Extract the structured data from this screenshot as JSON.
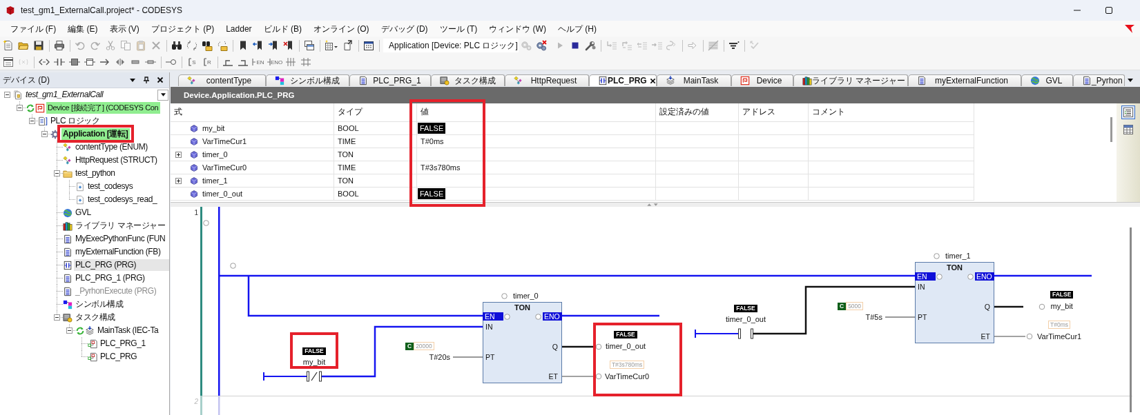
{
  "window": {
    "title": "test_gm1_ExternalCall.project* - CODESYS"
  },
  "menu_bar": [
    "ファイル (F)",
    "編集 (E)",
    "表示 (V)",
    "プロジェクト (P)",
    "Ladder",
    "ビルド (B)",
    "オンライン (O)",
    "デバッグ (D)",
    "ツール (T)",
    "ウィンドウ (W)",
    "ヘルプ (H)"
  ],
  "toolbar_1": [
    {
      "kind": "button",
      "disabled": false
    },
    {
      "kind": "button",
      "disabled": false
    },
    {
      "kind": "button",
      "disabled": false
    },
    {
      "kind": "separator"
    },
    {
      "kind": "button",
      "disabled": false
    },
    {
      "kind": "separator"
    },
    {
      "kind": "button",
      "disabled": true
    },
    {
      "kind": "button",
      "disabled": true
    },
    {
      "kind": "button",
      "disabled": true
    },
    {
      "kind": "button",
      "disabled": true
    },
    {
      "kind": "button",
      "disabled": true
    },
    {
      "kind": "button",
      "disabled": true
    },
    {
      "kind": "separator"
    },
    {
      "kind": "button",
      "disabled": false
    },
    {
      "kind": "button",
      "disabled": false
    },
    {
      "kind": "button",
      "disabled": false
    },
    {
      "kind": "button",
      "disabled": false
    },
    {
      "kind": "separator"
    },
    {
      "kind": "button",
      "disabled": false
    },
    {
      "kind": "button",
      "disabled": false
    },
    {
      "kind": "button",
      "disabled": false
    },
    {
      "kind": "button",
      "disabled": false
    },
    {
      "kind": "separator"
    },
    {
      "kind": "button",
      "disabled": false
    },
    {
      "kind": "separator"
    },
    {
      "kind": "button",
      "disabled": false
    },
    {
      "kind": "button",
      "disabled": false
    },
    {
      "kind": "separator"
    },
    {
      "kind": "button",
      "disabled": false
    },
    {
      "kind": "separator"
    },
    {
      "kind": "dropdown",
      "value": "Application [Device: PLC ロジック]"
    },
    {
      "kind": "button",
      "disabled": true
    },
    {
      "kind": "button",
      "disabled": false
    },
    {
      "kind": "button",
      "disabled": true
    },
    {
      "kind": "button",
      "disabled": false
    },
    {
      "kind": "button",
      "disabled": false
    },
    {
      "kind": "separator"
    },
    {
      "kind": "button",
      "disabled": true
    },
    {
      "kind": "button",
      "disabled": true
    },
    {
      "kind": "button",
      "disabled": true
    },
    {
      "kind": "button",
      "disabled": true
    },
    {
      "kind": "button",
      "disabled": true
    },
    {
      "kind": "separator"
    },
    {
      "kind": "button",
      "disabled": true
    },
    {
      "kind": "separator"
    },
    {
      "kind": "button",
      "disabled": true
    },
    {
      "kind": "separator"
    },
    {
      "kind": "button",
      "disabled": false
    },
    {
      "kind": "separator"
    },
    {
      "kind": "button",
      "disabled": true
    }
  ],
  "toolbar_2": [
    {
      "kind": "button",
      "disabled": false
    },
    {
      "kind": "button",
      "disabled": true
    },
    {
      "kind": "separator"
    },
    {
      "kind": "button",
      "disabled": false
    },
    {
      "kind": "button",
      "disabled": false
    },
    {
      "kind": "button",
      "disabled": false
    },
    {
      "kind": "button",
      "disabled": false
    },
    {
      "kind": "button",
      "disabled": false
    },
    {
      "kind": "button",
      "disabled": false
    },
    {
      "kind": "button",
      "disabled": false
    },
    {
      "kind": "button",
      "disabled": false
    },
    {
      "kind": "separator"
    },
    {
      "kind": "button",
      "disabled": false
    },
    {
      "kind": "separator"
    },
    {
      "kind": "button",
      "disabled": false,
      "label": "S"
    },
    {
      "kind": "button",
      "disabled": false,
      "label": "R"
    },
    {
      "kind": "separator"
    },
    {
      "kind": "button",
      "disabled": false
    },
    {
      "kind": "button",
      "disabled": false
    },
    {
      "kind": "button",
      "disabled": false,
      "label": "EN"
    },
    {
      "kind": "button",
      "disabled": false,
      "label": "ENO"
    },
    {
      "kind": "button",
      "disabled": false
    },
    {
      "kind": "button",
      "disabled": false
    }
  ],
  "devices_panel": {
    "title": "デバイス (D)",
    "tree": [
      {
        "label": "test_gm1_ExternalCall",
        "kind": "project",
        "selected": false,
        "online": false,
        "excluded": false,
        "expanded": true,
        "children": [
          {
            "label": "Device [接続完了] (CODESYS Con",
            "kind": "device",
            "selected": false,
            "online": true,
            "excluded": false,
            "expanded": true,
            "children": [
              {
                "label": "PLC ロジック",
                "kind": "plc-logic",
                "selected": false,
                "online": false,
                "excluded": false,
                "expanded": true,
                "children": [
                  {
                    "label": "Application [運転]",
                    "kind": "application",
                    "selected": false,
                    "online": true,
                    "excluded": false,
                    "highlighted": true,
                    "expanded": true,
                    "children": [
                      {
                        "label": "contentType (ENUM)",
                        "kind": "enum",
                        "selected": false,
                        "online": false,
                        "excluded": false
                      },
                      {
                        "label": "HttpRequest (STRUCT)",
                        "kind": "struct",
                        "selected": false,
                        "online": false,
                        "excluded": false
                      },
                      {
                        "label": "test_python",
                        "kind": "folder",
                        "selected": false,
                        "online": false,
                        "excluded": false,
                        "expanded": true,
                        "children": [
                          {
                            "label": "test_codesys",
                            "kind": "script",
                            "selected": false,
                            "online": false,
                            "excluded": false
                          },
                          {
                            "label": "test_codesys_read_",
                            "kind": "script",
                            "selected": false,
                            "online": false,
                            "excluded": false
                          }
                        ]
                      },
                      {
                        "label": "GVL",
                        "kind": "gvl",
                        "selected": false,
                        "online": false,
                        "excluded": false
                      },
                      {
                        "label": "ライブラリ マネージャー",
                        "kind": "library",
                        "selected": false,
                        "online": false,
                        "excluded": false
                      },
                      {
                        "label": "MyExecPythonFunc (FUN",
                        "kind": "pou",
                        "selected": false,
                        "online": false,
                        "excluded": false
                      },
                      {
                        "label": "myExternalFunction (FB)",
                        "kind": "pou",
                        "selected": false,
                        "online": false,
                        "excluded": false
                      },
                      {
                        "label": "PLC_PRG (PRG)",
                        "kind": "pou-ladder",
                        "selected": true,
                        "online": false,
                        "excluded": false
                      },
                      {
                        "label": "PLC_PRG_1 (PRG)",
                        "kind": "pou",
                        "selected": false,
                        "online": false,
                        "excluded": false
                      },
                      {
                        "label": "_PyrhonExecute (PRG)",
                        "kind": "pou",
                        "selected": false,
                        "online": false,
                        "excluded": true
                      },
                      {
                        "label": "シンボル構成",
                        "kind": "symbols",
                        "selected": false,
                        "online": false,
                        "excluded": false
                      },
                      {
                        "label": "タスク構成",
                        "kind": "task-config",
                        "selected": false,
                        "online": false,
                        "excluded": false,
                        "expanded": true,
                        "children": [
                          {
                            "label": "MainTask (IEC-Ta",
                            "kind": "task",
                            "selected": false,
                            "online": false,
                            "excluded": false,
                            "expanded": true,
                            "children": [
                              {
                                "label": "PLC_PRG_1",
                                "kind": "task-call",
                                "selected": false,
                                "online": false,
                                "excluded": false
                              },
                              {
                                "label": "PLC_PRG",
                                "kind": "task-call",
                                "selected": false,
                                "online": false,
                                "excluded": false
                              }
                            ]
                          }
                        ]
                      }
                    ]
                  }
                ]
              }
            ]
          }
        ]
      }
    ]
  },
  "editor_tabs": [
    {
      "label": "contentType",
      "kind": "enum",
      "selected": false
    },
    {
      "label": "シンボル構成",
      "kind": "symbols",
      "selected": false
    },
    {
      "label": "PLC_PRG_1",
      "kind": "pou",
      "selected": false
    },
    {
      "label": "タスク構成",
      "kind": "task-config",
      "selected": false
    },
    {
      "label": "HttpRequest",
      "kind": "struct",
      "selected": false
    },
    {
      "label": "PLC_PRG",
      "kind": "pou-ladder",
      "selected": true
    },
    {
      "label": "MainTask",
      "kind": "task",
      "selected": false
    },
    {
      "label": "Device",
      "kind": "device",
      "selected": false
    },
    {
      "label": "ライブラリ マネージャー",
      "kind": "library",
      "selected": false
    },
    {
      "label": "myExternalFunction",
      "kind": "pou",
      "selected": false
    },
    {
      "label": "GVL",
      "kind": "gvl",
      "selected": false
    },
    {
      "label": "_Pyrhon",
      "kind": "pou",
      "selected": false
    }
  ],
  "watch_list": {
    "title": "Device.Application.PLC_PRG",
    "columns": [
      {
        "label": "式",
        "highlighted": false
      },
      {
        "label": "タイプ",
        "highlighted": false
      },
      {
        "label": "値",
        "highlighted": true
      },
      {
        "label": "設定済みの値",
        "highlighted": false
      },
      {
        "label": "アドレス",
        "highlighted": false
      },
      {
        "label": "コメント",
        "highlighted": false
      }
    ],
    "rows": [
      {
        "expression": "my_bit",
        "type": "BOOL",
        "value": "FALSE",
        "kind": "bool"
      },
      {
        "expression": "VarTimeCur1",
        "type": "TIME",
        "value": "T#0ms",
        "kind": "time"
      },
      {
        "expression": "timer_0",
        "type": "TON",
        "kind": "fb",
        "expanded": false
      },
      {
        "expression": "VarTimeCur0",
        "type": "TIME",
        "value": "T#3s780ms",
        "kind": "time"
      },
      {
        "expression": "timer_1",
        "type": "TON",
        "kind": "fb",
        "expanded": false
      },
      {
        "expression": "timer_0_out",
        "type": "BOOL",
        "value": "FALSE",
        "kind": "bool"
      }
    ],
    "view_toggles": [
      {
        "selected": true
      },
      {
        "selected": false
      }
    ]
  },
  "ladder": {
    "networks": [
      {
        "number": "1",
        "elements": [
          {
            "kind": "contact",
            "variable": "my_bit",
            "value": "FALSE",
            "negated": true,
            "power_flow": true,
            "highlighted": true
          },
          {
            "kind": "block",
            "type": "TON",
            "instance": "timer_0",
            "highlighted": true,
            "inputs": [
              {
                "pin": "EN",
                "kind": "enable"
              },
              {
                "pin": "IN",
                "kind": "wired"
              },
              {
                "pin": "PT",
                "kind": "constant",
                "marker": "C",
                "constant": "20000",
                "value": "T#20s"
              }
            ],
            "outputs": [
              {
                "pin": "ENO",
                "kind": "enable"
              },
              {
                "pin": "Q",
                "kind": "bool",
                "variable": "timer_0_out",
                "value": "FALSE",
                "power_flow": false
              },
              {
                "pin": "ET",
                "kind": "time",
                "variable": "VarTimeCur0",
                "value": "T#3s780ms"
              }
            ]
          },
          {
            "kind": "contact",
            "variable": "timer_0_out",
            "value": "FALSE",
            "negated": false,
            "power_flow": false,
            "highlighted": false
          },
          {
            "kind": "block",
            "type": "TON",
            "instance": "timer_1",
            "highlighted": false,
            "inputs": [
              {
                "pin": "EN",
                "kind": "enable"
              },
              {
                "pin": "IN",
                "kind": "wired"
              },
              {
                "pin": "PT",
                "kind": "constant",
                "marker": "C",
                "constant": "5000",
                "value": "T#5s"
              }
            ],
            "outputs": [
              {
                "pin": "ENO",
                "kind": "enable"
              },
              {
                "pin": "Q",
                "kind": "bool",
                "variable": "my_bit",
                "value": "FALSE",
                "power_flow": false
              },
              {
                "pin": "ET",
                "kind": "time",
                "variable": "VarTimeCur1",
                "value": "T#0ms"
              }
            ]
          }
        ]
      },
      {
        "number": "2"
      }
    ]
  }
}
